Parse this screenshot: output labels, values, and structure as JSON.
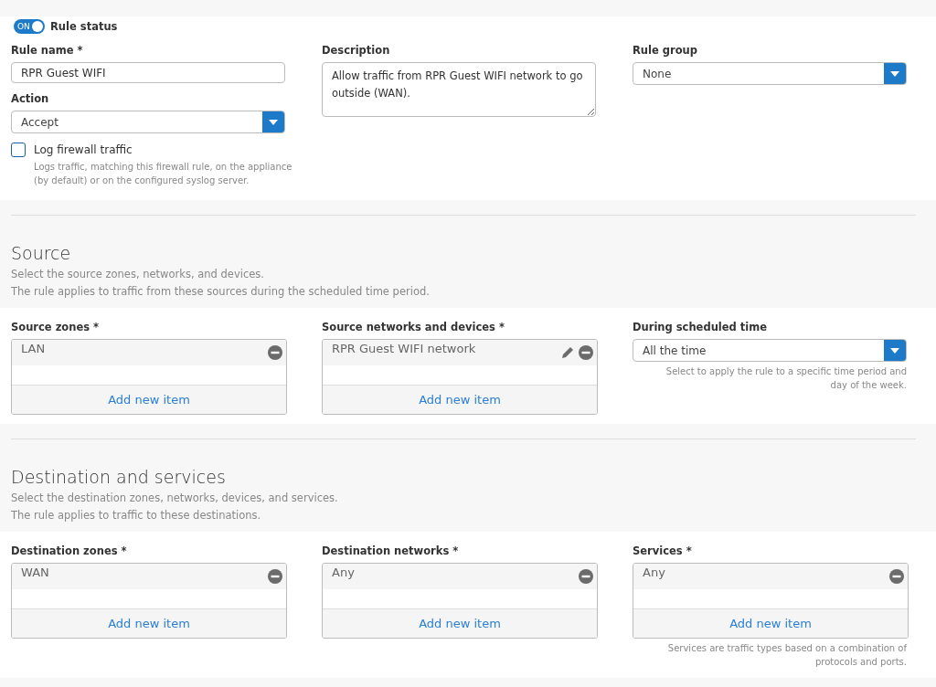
{
  "rule_status": {
    "label": "Rule status",
    "toggle_text": "ON",
    "on": true
  },
  "general": {
    "rule_name": {
      "label": "Rule name *",
      "value": "RPR Guest WIFI"
    },
    "action": {
      "label": "Action",
      "value": "Accept"
    },
    "log_traffic": {
      "label": "Log firewall traffic",
      "checked": false,
      "hint": "Logs traffic, matching this firewall rule, on the appliance (by default) or on the configured syslog server."
    },
    "description": {
      "label": "Description",
      "value": "Allow traffic from RPR Guest WIFI network to go outside (WAN)."
    },
    "rule_group": {
      "label": "Rule group",
      "value": "None"
    }
  },
  "sections": [
    {
      "title": "Source",
      "lines": [
        "Select the source zones, networks, and devices.",
        "The rule applies to traffic from these sources during the scheduled time period."
      ],
      "fields": [
        {
          "kind": "list",
          "label": "Source zones *",
          "items": [
            {
              "text": "LAN",
              "editable": false
            }
          ],
          "add_label": "Add new item"
        },
        {
          "kind": "list",
          "label": "Source networks and devices *",
          "items": [
            {
              "text": "RPR Guest WIFI network",
              "editable": true
            }
          ],
          "add_label": "Add new item"
        },
        {
          "kind": "select",
          "label": "During scheduled time",
          "value": "All the time",
          "hint": "Select to apply the rule to a specific time period and day of the week."
        }
      ]
    },
    {
      "title": "Destination and services",
      "lines": [
        "Select the destination zones, networks, devices, and services.",
        "The rule applies to traffic to these destinations."
      ],
      "fields": [
        {
          "kind": "list",
          "label": "Destination zones *",
          "items": [
            {
              "text": "WAN",
              "editable": false
            }
          ],
          "add_label": "Add new item"
        },
        {
          "kind": "list",
          "label": "Destination networks *",
          "items": [
            {
              "text": "Any",
              "editable": false
            }
          ],
          "add_label": "Add new item"
        },
        {
          "kind": "list",
          "label": "Services *",
          "items": [
            {
              "text": "Any",
              "editable": false
            }
          ],
          "add_label": "Add new item",
          "hint": "Services are traffic types based on a combination of protocols and ports."
        }
      ]
    }
  ]
}
